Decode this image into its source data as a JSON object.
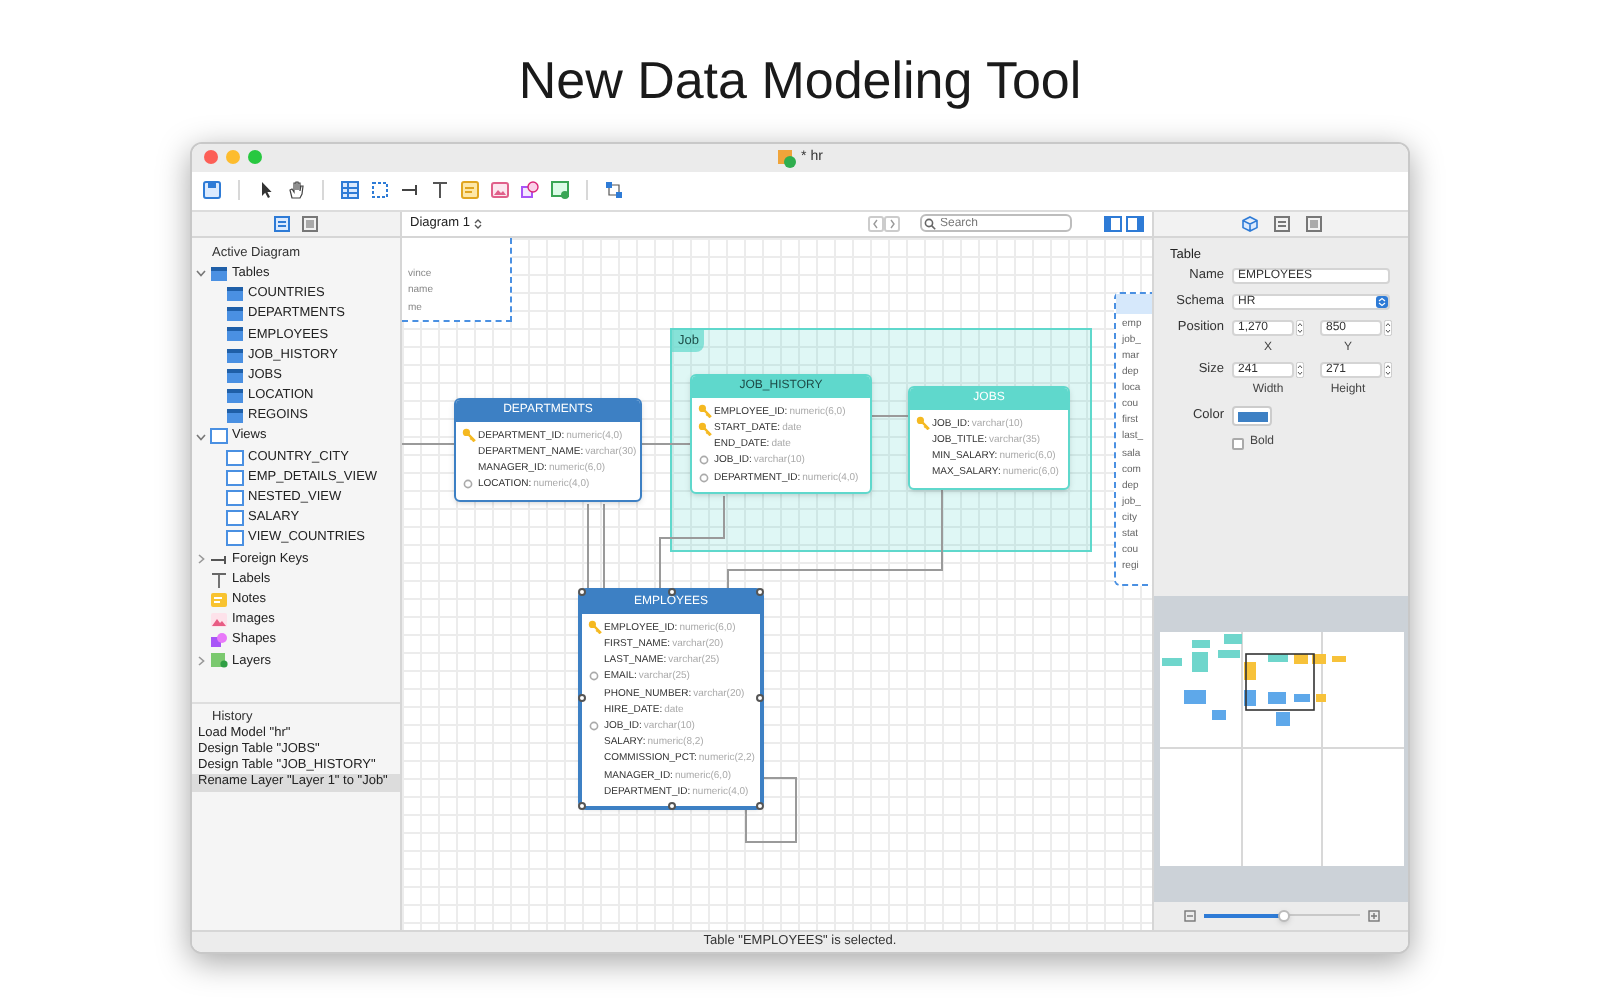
{
  "page_title": "New Data Modeling Tool",
  "window": {
    "title": "* hr"
  },
  "diagram_tab": {
    "label": "Diagram 1",
    "search_placeholder": "Search"
  },
  "sidebar": {
    "heading": "Active Diagram",
    "tree": [
      {
        "label": "Tables",
        "kind": "tables",
        "expanded": true,
        "children": [
          {
            "label": "COUNTRIES",
            "kind": "table"
          },
          {
            "label": "DEPARTMENTS",
            "kind": "table"
          },
          {
            "label": "EMPLOYEES",
            "kind": "table"
          },
          {
            "label": "JOB_HISTORY",
            "kind": "table"
          },
          {
            "label": "JOBS",
            "kind": "table"
          },
          {
            "label": "LOCATION",
            "kind": "table"
          },
          {
            "label": "REGOINS",
            "kind": "table"
          }
        ]
      },
      {
        "label": "Views",
        "kind": "views",
        "expanded": true,
        "children": [
          {
            "label": "COUNTRY_CITY",
            "kind": "view"
          },
          {
            "label": "EMP_DETAILS_VIEW",
            "kind": "view"
          },
          {
            "label": "NESTED_VIEW",
            "kind": "view"
          },
          {
            "label": "SALARY",
            "kind": "view"
          },
          {
            "label": "VIEW_COUNTRIES",
            "kind": "view"
          }
        ]
      },
      {
        "label": "Foreign Keys",
        "kind": "foreign-keys",
        "expanded": false
      },
      {
        "label": "Labels",
        "kind": "labels"
      },
      {
        "label": "Notes",
        "kind": "notes"
      },
      {
        "label": "Images",
        "kind": "images"
      },
      {
        "label": "Shapes",
        "kind": "shapes"
      },
      {
        "label": "Layers",
        "kind": "layers",
        "expanded": false
      }
    ]
  },
  "history": {
    "heading": "History",
    "items": [
      {
        "label": "Load Model \"hr\"",
        "selected": false
      },
      {
        "label": "Design Table \"JOBS\"",
        "selected": false
      },
      {
        "label": "Design Table \"JOB_HISTORY\"",
        "selected": false
      },
      {
        "label": "Rename Layer \"Layer 1\" to \"Job\"",
        "selected": true
      }
    ]
  },
  "diagram": {
    "layers": [
      {
        "label": "Job"
      }
    ],
    "partial_views": [
      {
        "columns": [
          "vince",
          "name",
          "me"
        ]
      },
      {
        "columns": [
          "emp",
          "job_",
          "mar",
          "dep",
          "loca",
          "cou",
          "first",
          "last_",
          "sala",
          "com",
          "dep",
          "job_",
          "city",
          "stat",
          "cou",
          "regi"
        ]
      }
    ],
    "tables": [
      {
        "name": "DEPARTMENTS",
        "color": "#3d80c4",
        "selected": false,
        "columns": [
          {
            "name": "DEPARTMENT_ID:",
            "type": "numeric(4,0)",
            "kind": "primary"
          },
          {
            "name": "DEPARTMENT_NAME:",
            "type": "varchar(30)",
            "kind": "plain"
          },
          {
            "name": "MANAGER_ID:",
            "type": "numeric(6,0)",
            "kind": "plain"
          },
          {
            "name": "LOCATION:",
            "type": "numeric(4,0)",
            "kind": "foreign"
          }
        ]
      },
      {
        "name": "JOB_HISTORY",
        "color": "#5fd8cc",
        "selected": false,
        "columns": [
          {
            "name": "EMPLOYEE_ID:",
            "type": "numeric(6,0)",
            "kind": "primary"
          },
          {
            "name": "START_DATE:",
            "type": "date",
            "kind": "primary"
          },
          {
            "name": "END_DATE:",
            "type": "date",
            "kind": "plain"
          },
          {
            "name": "JOB_ID:",
            "type": "varchar(10)",
            "kind": "foreign"
          },
          {
            "name": "DEPARTMENT_ID:",
            "type": "numeric(4,0)",
            "kind": "foreign"
          }
        ]
      },
      {
        "name": "JOBS",
        "color": "#5fd8cc",
        "selected": false,
        "columns": [
          {
            "name": "JOB_ID:",
            "type": "varchar(10)",
            "kind": "primary"
          },
          {
            "name": "JOB_TITLE:",
            "type": "varchar(35)",
            "kind": "plain"
          },
          {
            "name": "MIN_SALARY:",
            "type": "numeric(6,0)",
            "kind": "plain"
          },
          {
            "name": "MAX_SALARY:",
            "type": "numeric(6,0)",
            "kind": "plain"
          }
        ]
      },
      {
        "name": "EMPLOYEES",
        "color": "#3d80c4",
        "selected": true,
        "columns": [
          {
            "name": "EMPLOYEE_ID:",
            "type": "numeric(6,0)",
            "kind": "primary"
          },
          {
            "name": "FIRST_NAME:",
            "type": "varchar(20)",
            "kind": "plain"
          },
          {
            "name": "LAST_NAME:",
            "type": "varchar(25)",
            "kind": "plain"
          },
          {
            "name": "EMAIL:",
            "type": "varchar(25)",
            "kind": "foreign"
          },
          {
            "name": "PHONE_NUMBER:",
            "type": "varchar(20)",
            "kind": "plain"
          },
          {
            "name": "HIRE_DATE:",
            "type": "date",
            "kind": "plain"
          },
          {
            "name": "JOB_ID:",
            "type": "varchar(10)",
            "kind": "foreign"
          },
          {
            "name": "SALARY:",
            "type": "numeric(8,2)",
            "kind": "plain"
          },
          {
            "name": "COMMISSION_PCT:",
            "type": "numeric(2,2)",
            "kind": "plain"
          },
          {
            "name": "MANAGER_ID:",
            "type": "numeric(6,0)",
            "kind": "plain"
          },
          {
            "name": "DEPARTMENT_ID:",
            "type": "numeric(4,0)",
            "kind": "plain"
          }
        ]
      }
    ]
  },
  "inspector": {
    "heading": "Table",
    "fields": [
      {
        "kind": "text",
        "label": "Name",
        "value": "EMPLOYEES"
      },
      {
        "kind": "select",
        "label": "Schema",
        "value": "HR"
      },
      {
        "kind": "pair",
        "label": "Position",
        "values": [
          {
            "value": "1,270",
            "caption": "X"
          },
          {
            "value": "850",
            "caption": "Y"
          }
        ]
      },
      {
        "kind": "pair",
        "label": "Size",
        "values": [
          {
            "value": "241",
            "caption": "Width"
          },
          {
            "value": "271",
            "caption": "Height"
          }
        ]
      },
      {
        "kind": "color",
        "label": "Color",
        "color": "#3d80c4"
      },
      {
        "kind": "checkbox",
        "label": "Bold",
        "checked": false
      }
    ]
  },
  "zoom": {
    "level": 0.52
  },
  "status_bar": "Table \"EMPLOYEES\" is selected."
}
